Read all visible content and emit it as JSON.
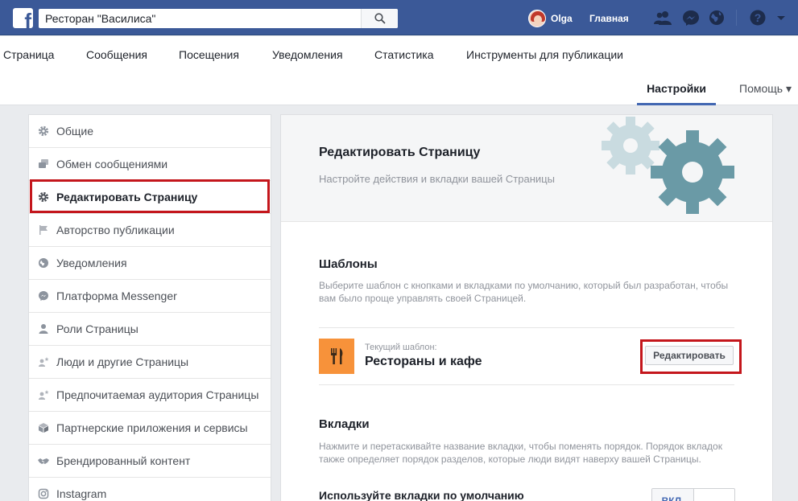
{
  "topbar": {
    "search_value": "Ресторан \"Василиса\"",
    "user_name": "Olga",
    "home_label": "Главная"
  },
  "pagenav": {
    "items": [
      "Страница",
      "Сообщения",
      "Посещения",
      "Уведомления",
      "Статистика",
      "Инструменты для публикации"
    ],
    "settings_label": "Настройки",
    "help_label": "Помощь ▾"
  },
  "sidebar": {
    "items": [
      {
        "label": "Общие",
        "icon": "gear-icon"
      },
      {
        "label": "Обмен сообщениями",
        "icon": "chat-bubbles-icon"
      },
      {
        "label": "Редактировать Страницу",
        "icon": "gear-icon"
      },
      {
        "label": "Авторство публикации",
        "icon": "flag-icon"
      },
      {
        "label": "Уведомления",
        "icon": "globe-icon"
      },
      {
        "label": "Платформа Messenger",
        "icon": "messenger-icon"
      },
      {
        "label": "Роли Страницы",
        "icon": "person-icon"
      },
      {
        "label": "Люди и другие Страницы",
        "icon": "people-star-icon"
      },
      {
        "label": "Предпочитаемая аудитория Страницы",
        "icon": "people-star-icon"
      },
      {
        "label": "Партнерские приложения и сервисы",
        "icon": "cube-icon"
      },
      {
        "label": "Брендированный контент",
        "icon": "handshake-icon"
      },
      {
        "label": "Instagram",
        "icon": "instagram-icon"
      }
    ],
    "active_index": 2
  },
  "main": {
    "title": "Редактировать Страницу",
    "subtitle": "Настройте действия и вкладки вашей Страницы",
    "templates": {
      "title": "Шаблоны",
      "description": "Выберите шаблон с кнопками и вкладками по умолчанию, который был разработан, чтобы вам было проще управлять своей Страницей.",
      "current_label": "Текущий шаблон:",
      "current_name": "Рестораны и кафе",
      "edit_button": "Редактировать"
    },
    "tabs": {
      "title": "Вкладки",
      "description": "Нажмите и перетаскивайте название вкладки, чтобы поменять порядок. Порядок вкладок также определяет порядок разделов, которые люди видят наверху вашей Страницы.",
      "default_tabs_label": "Используйте вкладки по умолчанию",
      "toggle_on": "ВКЛ."
    }
  },
  "colors": {
    "facebook_blue": "#3b5998",
    "highlight_red": "#c4161c",
    "template_orange": "#f7923a",
    "gear_light": "#c9dbe0",
    "gear_dark": "#6a9aa6"
  }
}
